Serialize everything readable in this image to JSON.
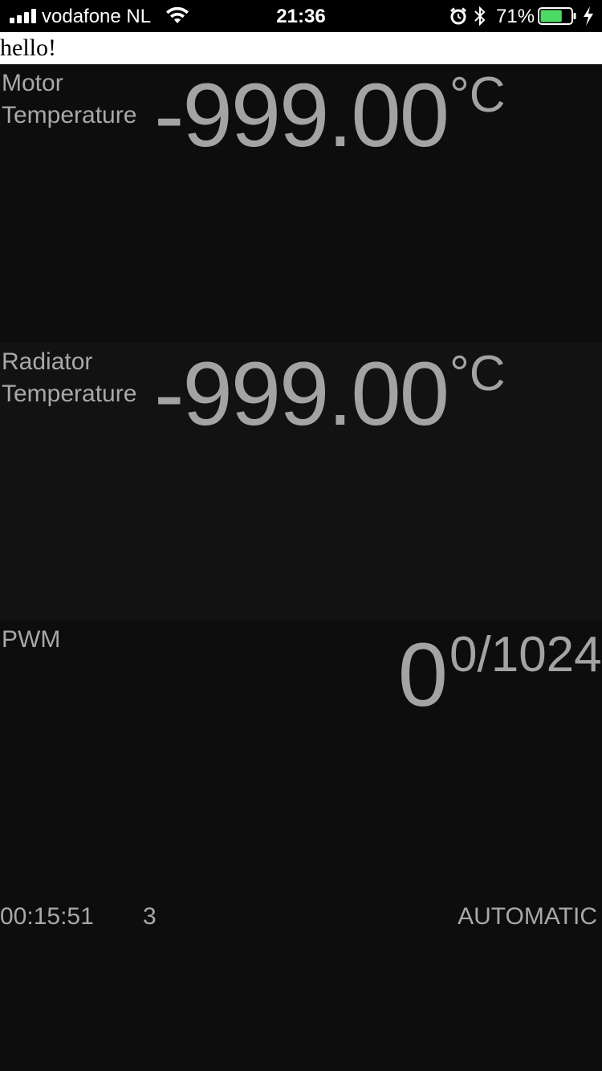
{
  "status_bar": {
    "carrier": "vodafone NL",
    "time": "21:36",
    "battery_percent": "71%",
    "battery_level": 0.71,
    "icons": [
      "signal-icon",
      "wifi-icon",
      "alarm-icon",
      "bluetooth-icon",
      "battery-icon",
      "charging-bolt-icon"
    ],
    "battery_color": "#4cd964"
  },
  "header": {
    "greeting": "hello!"
  },
  "motor": {
    "label_line1": "Motor",
    "label_line2": "Temperature",
    "value": "-999.00",
    "unit": "°C"
  },
  "radiator": {
    "label_line1": "Radiator",
    "label_line2": "Temperature",
    "value": "-999.00",
    "unit": "°C"
  },
  "pwm": {
    "label": "PWM",
    "value": "0",
    "max": "0/1024"
  },
  "footer": {
    "uptime": "00:15:51",
    "count": "3",
    "mode": "AUTOMATIC"
  }
}
